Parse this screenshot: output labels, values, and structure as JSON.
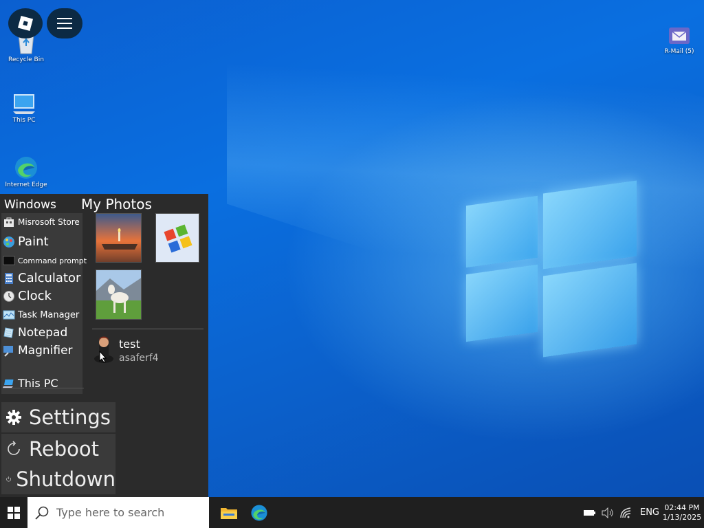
{
  "desktop": {
    "icons": [
      {
        "label": "Recycle Bin",
        "icon": "recycle-bin-icon"
      },
      {
        "label": "This PC",
        "icon": "computer-icon"
      },
      {
        "label": "Internet Edge",
        "icon": "edge-icon"
      },
      {
        "label": "R-Mail (5)",
        "icon": "mail-icon"
      }
    ]
  },
  "top_buttons": [
    {
      "icon": "roblox-icon"
    },
    {
      "icon": "hamburger-menu-icon"
    }
  ],
  "start_menu": {
    "apps_header": "Windows",
    "photos_header": "My Photos",
    "apps": [
      {
        "label": "Misrosoft Store",
        "icon": "store-icon"
      },
      {
        "label": "Paint",
        "icon": "paint-icon"
      },
      {
        "label": "Command prompt",
        "icon": "terminal-icon"
      },
      {
        "label": "Calculator",
        "icon": "calculator-icon"
      },
      {
        "label": "Clock",
        "icon": "clock-icon"
      },
      {
        "label": "Task Manager",
        "icon": "task-manager-icon"
      },
      {
        "label": "Notepad",
        "icon": "notepad-icon"
      },
      {
        "label": "Magnifier",
        "icon": "magnifier-icon"
      },
      {
        "label": "This PC",
        "icon": "computer-icon"
      }
    ],
    "photos": [
      {
        "subject": "candle-sunset"
      },
      {
        "subject": "windows-xp-logo"
      },
      {
        "subject": "goat-meadow"
      }
    ],
    "user": {
      "name": "test",
      "handle": "asaferf4"
    },
    "power": [
      {
        "label": "Settings",
        "icon": "gear-icon"
      },
      {
        "label": "Reboot",
        "icon": "reboot-icon"
      },
      {
        "label": "Shutdown",
        "icon": "power-icon"
      }
    ]
  },
  "taskbar": {
    "search_placeholder": "Type here to search",
    "pinned": [
      {
        "icon": "file-explorer-icon"
      },
      {
        "icon": "edge-icon"
      }
    ],
    "tray": {
      "language": "ENG",
      "time": "02:44 PM",
      "date": "1/13/2025"
    }
  },
  "colors": {
    "taskbar_bg": "#1f1f1f",
    "start_bg": "#2b2b2b",
    "panel_bg": "#3a3a3a",
    "wallpaper_blue": "#0a6fe0"
  }
}
